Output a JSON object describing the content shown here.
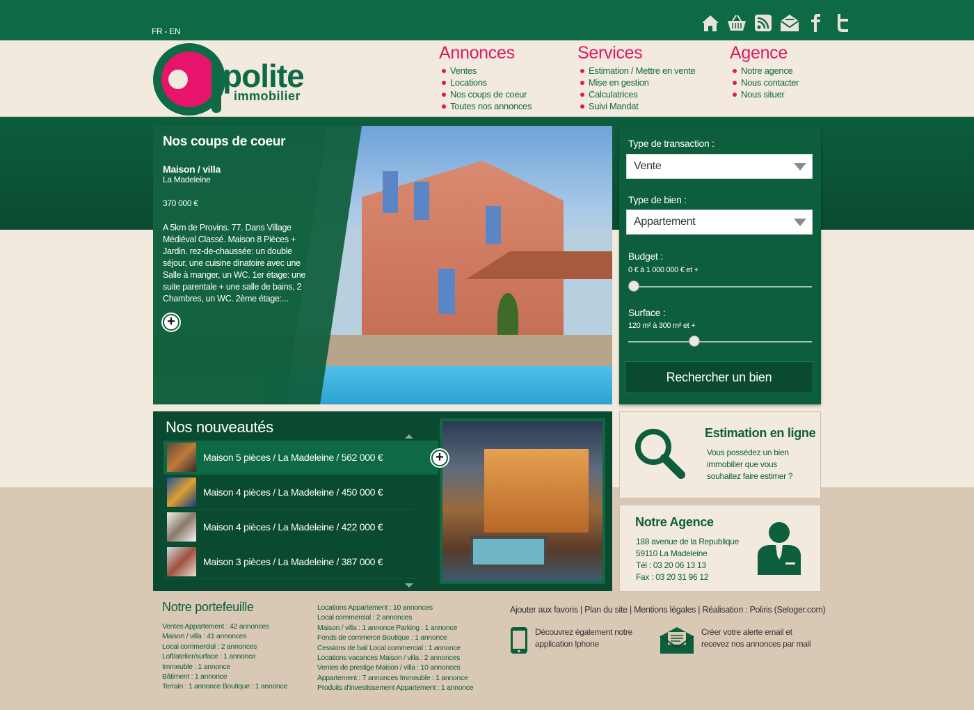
{
  "header": {
    "lang": "FR - EN",
    "top_icons": [
      "home-icon",
      "basket-icon",
      "rss-icon",
      "mail-icon",
      "facebook-icon",
      "twitter-icon"
    ]
  },
  "logo": {
    "word": "polite",
    "sub": "immobilier"
  },
  "nav": [
    {
      "title": "Annonces",
      "items": [
        "Ventes",
        "Locations",
        "Nos coups de coeur",
        "Toutes nos annonces"
      ]
    },
    {
      "title": "Services",
      "items": [
        "Estimation / Mettre en vente",
        "Mise en gestion",
        "Calculatrices",
        "Suivi Mandat"
      ]
    },
    {
      "title": "Agence",
      "items": [
        "Notre agence",
        "Nous contacter",
        "Nous situer"
      ]
    }
  ],
  "featured": {
    "heading": "Nos coups de coeur",
    "type": "Maison / villa",
    "city": "La Madeleine",
    "price": "370 000 €",
    "description": "A 5km de Provins. 77. Dans Village Médiéval Classé. Maison 8 Pièces + Jardin. rez-de-chaussée: un double séjour, une cuisine dinatoire avec une Salle à manger, un WC. 1er étage: une suite parentale + une salle de bains, 2 Chambres, un WC. 2ème étage:...",
    "plus": "+"
  },
  "search": {
    "transaction_label": "Type de transaction :",
    "transaction_value": "Vente",
    "bien_label": "Type de bien :",
    "bien_value": "Appartement",
    "budget_label": "Budget :",
    "budget_range": "0 € à 1 000 000 € et +",
    "budget_level": 0.0,
    "surface_label": "Surface :",
    "surface_range": "120 m² à 300 m² et +",
    "surface_level": 0.35,
    "button": "Rechercher un bien"
  },
  "nouveautes": {
    "heading": "Nos nouveautés",
    "items": [
      "Maison 5 pièces / La Madeleine / 562 000 €",
      "Maison 4 pièces / La Madeleine / 450 000 €",
      "Maison 4 pièces / La Madeleine / 422 000 €",
      "Maison 3 pièces / La Madeleine / 387 000 €"
    ],
    "plus": "+"
  },
  "estimation": {
    "title": "Estimation en ligne",
    "text": "Vous possédez un bien immobilier que vous souhaitez faire estimer ?"
  },
  "agence": {
    "title": "Notre Agence",
    "line1": "188 avenue de la Republique",
    "line2": "59110 La Madeleine",
    "tel": "Tél : 03 20 06 13 13",
    "fax": "Fax : 03 20 31 96 12"
  },
  "portefeuille": {
    "title": "Notre portefeuille",
    "col1": [
      "Ventes Appartement : 42 annonces",
      "Maison / villa : 41 annonces",
      "Local commercial : 2 annonces",
      "Loft/atelier/surface : 1 annonce",
      "Immeuble : 1 annonce",
      "Bâtiment : 1 annonce",
      "Terrain : 1 annonce Boutique : 1 annonce"
    ],
    "col2": [
      "Locations Appartement : 10 annonces",
      "Local commercial : 2 annonces",
      "Maison / villa : 1 annonce Parking : 1 annonce",
      "Fonds de commerce Boutique : 1 annonce",
      "Cessions de bail Local commercial : 1 annonce",
      "Locations vacances Maison / villa : 2 annonces",
      "Ventes de prestige Maison / villa : 10 annonces",
      "Appartement : 7 annonces Immeuble : 1 annonce",
      "Produits d'investissement Appartement : 1 annonce"
    ]
  },
  "footer": {
    "links": "Ajouter aux favoris | Plan du site | Mentions légales | Réalisation : Poliris (Seloger.com)",
    "app_text": "Découvrez également notre application Iphone",
    "alert_text": "Créer votre alerte email et recevez nos annonces par mail"
  }
}
